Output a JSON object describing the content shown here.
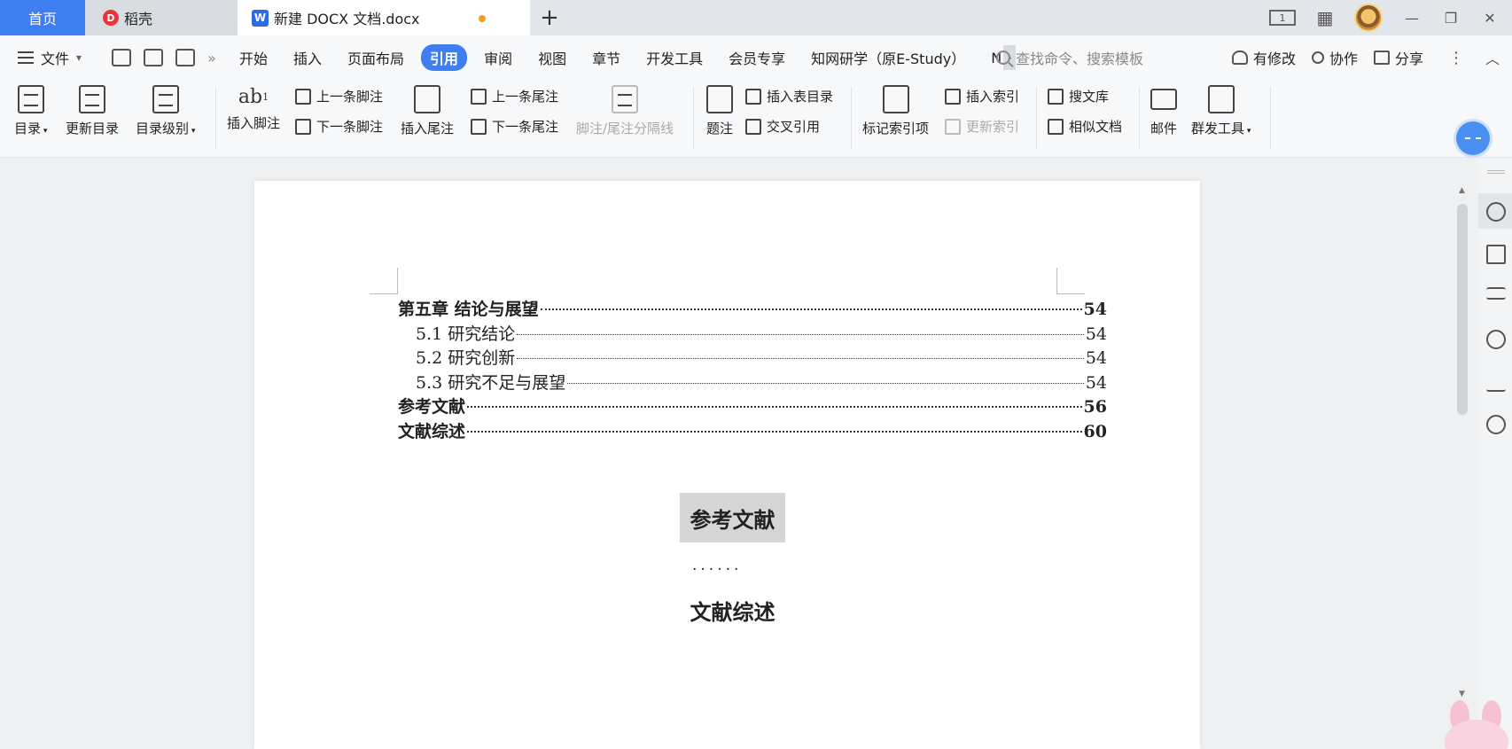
{
  "tabs": {
    "home": "首页",
    "daoke": "稻壳",
    "doc_title": "新建 DOCX 文档.docx",
    "new_tab": "+"
  },
  "window": {
    "layout_indicator": "1",
    "minimize": "—",
    "restore": "❐",
    "close": "✕"
  },
  "menubar": {
    "file": "文件",
    "tabs": [
      "开始",
      "插入",
      "页面布局",
      "引用",
      "审阅",
      "视图",
      "章节",
      "开发工具",
      "会员专享",
      "知网研学（原E-Study）",
      "N"
    ],
    "active_tab": "引用",
    "search_placeholder": "查找命令、搜索模板",
    "modified": "有修改",
    "collaborate": "协作",
    "share": "分享"
  },
  "ribbon": {
    "toc": "目录",
    "update_toc": "更新目录",
    "toc_level": "目录级别",
    "insert_footnote": "插入脚注",
    "prev_footnote": "上一条脚注",
    "next_footnote": "下一条脚注",
    "insert_endnote": "插入尾注",
    "prev_endnote": "上一条尾注",
    "next_endnote": "下一条尾注",
    "note_separator": "脚注/尾注分隔线",
    "caption": "题注",
    "insert_table_of_figures": "插入表目录",
    "cross_reference": "交叉引用",
    "mark_index": "标记索引项",
    "insert_index": "插入索引",
    "update_index": "更新索引",
    "search_library": "搜文库",
    "similar_docs": "相似文档",
    "mail": "邮件",
    "mass_tools": "群发工具",
    "ab_glyph": "ab"
  },
  "document": {
    "toc": [
      {
        "text": "第五章  结论与展望",
        "page": "54",
        "level": 1
      },
      {
        "text": "5.1 研究结论",
        "page": "54",
        "level": 2
      },
      {
        "text": "5.2 研究创新",
        "page": "54",
        "level": 2
      },
      {
        "text": "5.3 研究不足与展望",
        "page": "54",
        "level": 2
      },
      {
        "text": "参考文献",
        "page": "56",
        "level": 1
      },
      {
        "text": "文献综述",
        "page": "60",
        "level": 1
      }
    ],
    "heading_references": "参考文献",
    "ellipsis": "......",
    "heading_literature_review": "文献综述"
  },
  "colors": {
    "accent": "#3f7ef0",
    "modified_dot": "#f0a020"
  }
}
